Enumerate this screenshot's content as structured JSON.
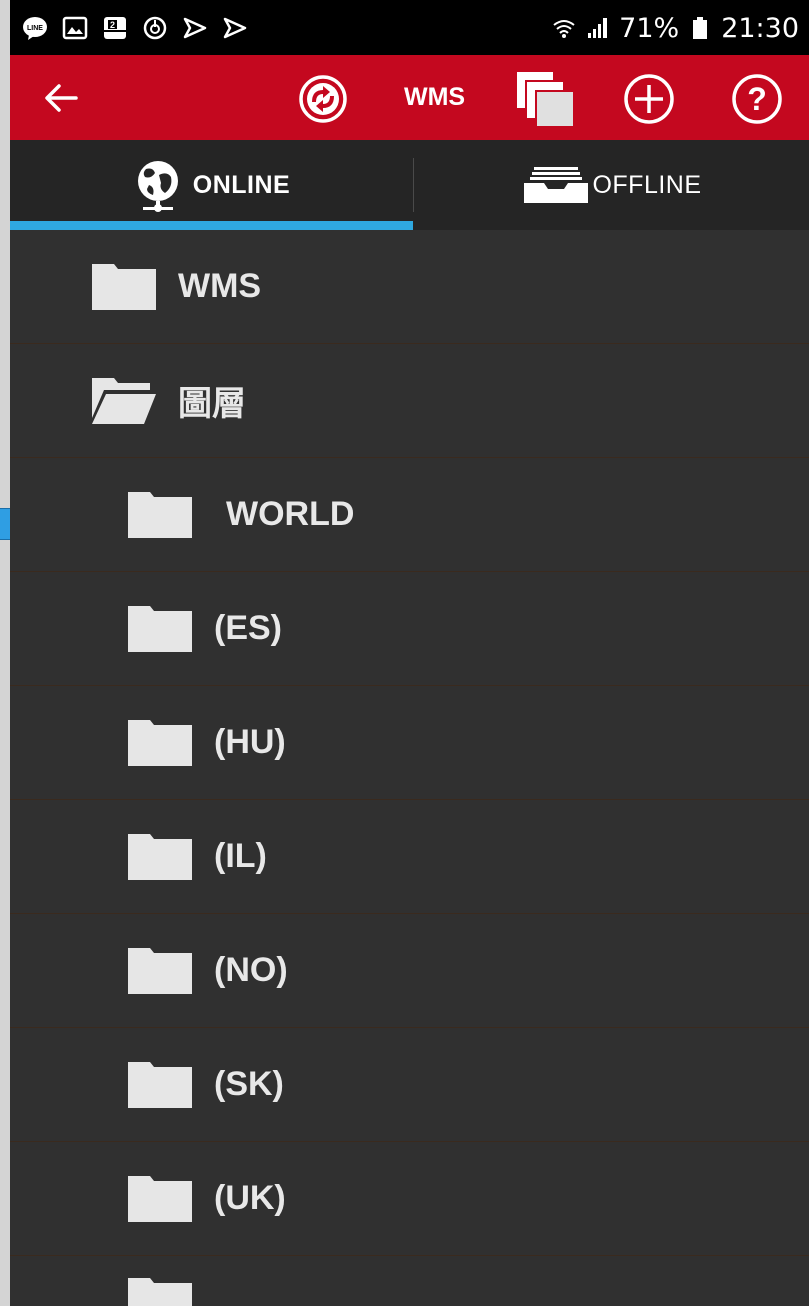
{
  "status_bar": {
    "battery": "71%",
    "time": "21:30",
    "left_icons": [
      "line-icon",
      "image-icon",
      "calendar-icon",
      "power-saving-icon",
      "play-store-icon",
      "play-store-icon"
    ],
    "right_icons": [
      "wifi-icon",
      "signal-icon",
      "battery-icon"
    ]
  },
  "app_bar": {
    "title": "WMS",
    "color": "#c4081f",
    "icons": [
      "back-arrow-icon",
      "sync-icon",
      "layers-icon",
      "add-circle-icon",
      "help-icon"
    ]
  },
  "tabs": [
    {
      "label": "ONLINE",
      "icon": "globe-network-icon",
      "selected": true
    },
    {
      "label": "OFFLINE",
      "icon": "tray-icon",
      "selected": false
    }
  ],
  "tree": [
    {
      "label": "WMS",
      "level": 0,
      "folder": "closed"
    },
    {
      "label": "圖層",
      "level": 0,
      "folder": "open"
    },
    {
      "label": "WORLD",
      "level": 1,
      "folder": "closed",
      "selected": true
    },
    {
      "label": "(ES)",
      "level": 1,
      "folder": "closed"
    },
    {
      "label": "(HU)",
      "level": 1,
      "folder": "closed"
    },
    {
      "label": "(IL)",
      "level": 1,
      "folder": "closed"
    },
    {
      "label": "(NO)",
      "level": 1,
      "folder": "closed"
    },
    {
      "label": "(SK)",
      "level": 1,
      "folder": "closed"
    },
    {
      "label": "(UK)",
      "level": 1,
      "folder": "closed"
    }
  ],
  "colors": {
    "accent": "#2fa8e0",
    "background": "#303030",
    "tab_bar": "#252525"
  }
}
